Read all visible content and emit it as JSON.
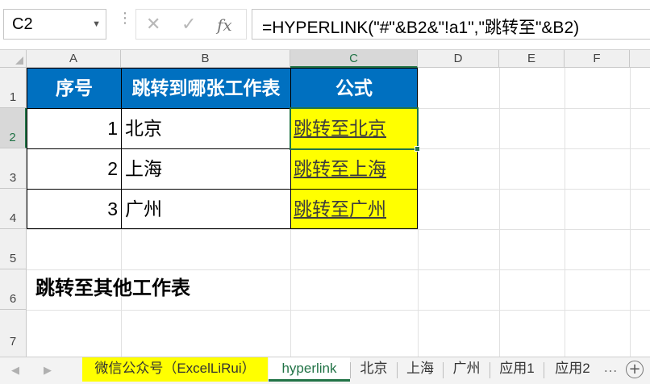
{
  "formula_bar": {
    "name_box": "C2",
    "formula": "=HYPERLINK(\"#\"&B2&\"!a1\",\"跳转至\"&B2)",
    "cancel_icon": "✕",
    "enter_icon": "✓",
    "fx_label": "fx"
  },
  "columns": [
    "A",
    "B",
    "C",
    "D",
    "E",
    "F"
  ],
  "rows": [
    "1",
    "2",
    "3",
    "4",
    "5",
    "6",
    "7"
  ],
  "selected_cell": "C2",
  "table": {
    "headers": [
      "序号",
      "跳转到哪张工作表",
      "公式"
    ],
    "rows": [
      {
        "num": "1",
        "sheet": "北京",
        "link": "跳转至北京"
      },
      {
        "num": "2",
        "sheet": "上海",
        "link": "跳转至上海"
      },
      {
        "num": "3",
        "sheet": "广州",
        "link": "跳转至广州"
      }
    ]
  },
  "note": "跳转至其他工作表",
  "sheet_tabs": [
    {
      "label": "微信公众号（ExcelLiRui）",
      "state": "highlighted"
    },
    {
      "label": "hyperlink",
      "state": "active"
    },
    {
      "label": "北京",
      "state": "normal"
    },
    {
      "label": "上海",
      "state": "normal"
    },
    {
      "label": "广州",
      "state": "normal"
    },
    {
      "label": "应用1",
      "state": "normal"
    },
    {
      "label": "应用2",
      "state": "normal"
    }
  ],
  "colors": {
    "header_fill": "#0070c0",
    "link_fill": "#ffff00",
    "excel_green": "#217346"
  },
  "icons": {
    "prev_sheet": "◀",
    "next_sheet": "▶",
    "more_tabs": "…",
    "add_sheet": "+",
    "name_box_dropdown": "▼"
  }
}
